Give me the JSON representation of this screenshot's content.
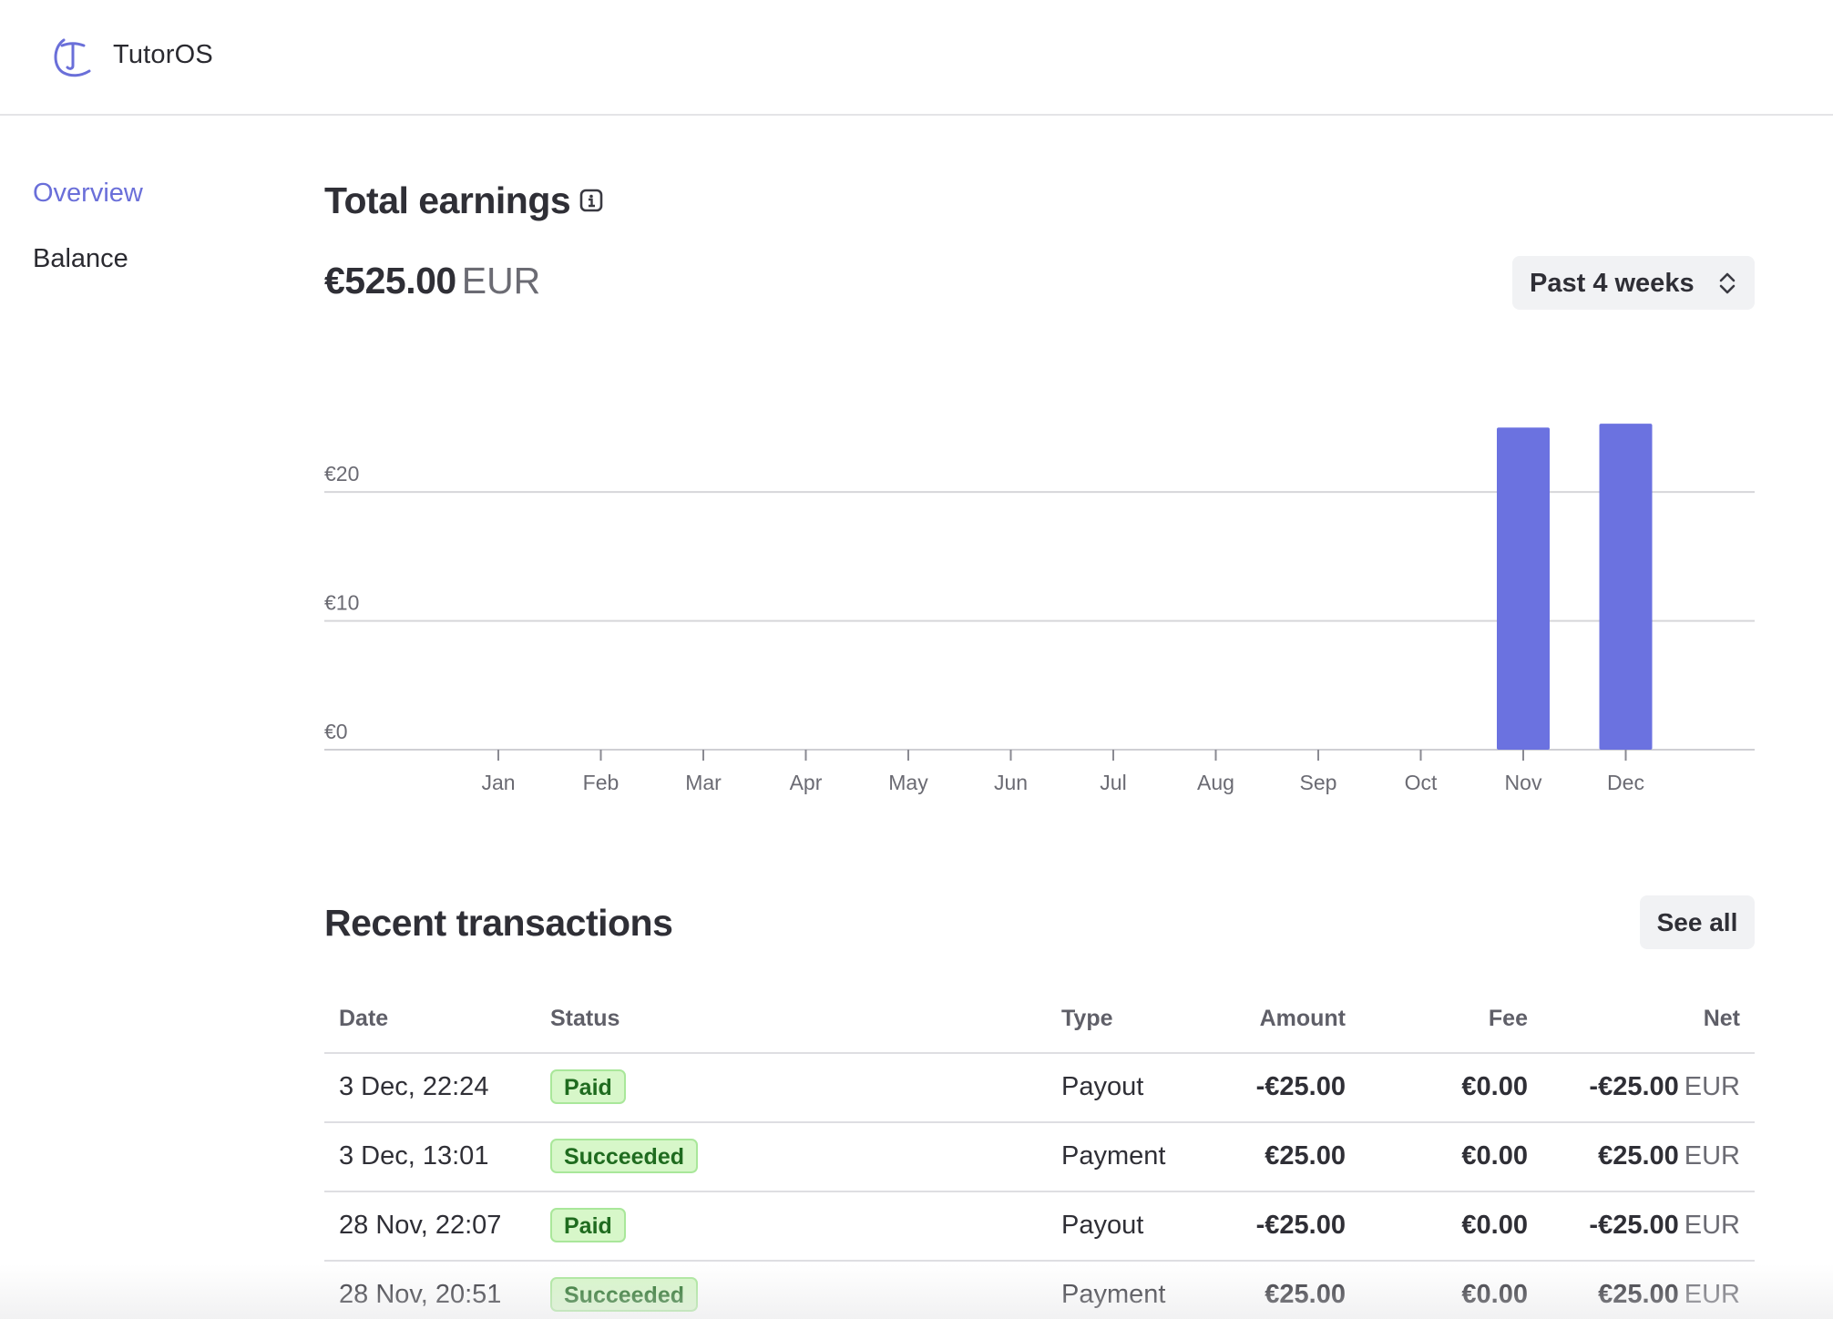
{
  "app": {
    "name": "TutorOS"
  },
  "nav": {
    "items": [
      {
        "label": "Overview"
      },
      {
        "label": "Balance"
      }
    ]
  },
  "earnings": {
    "title": "Total earnings",
    "amount": "€525.00",
    "currency": "EUR",
    "period": {
      "selected": "Past 4 weeks"
    }
  },
  "chart_data": {
    "type": "bar",
    "categories": [
      "Jan",
      "Feb",
      "Mar",
      "Apr",
      "May",
      "Jun",
      "Jul",
      "Aug",
      "Sep",
      "Oct",
      "Nov",
      "Dec"
    ],
    "values": [
      0,
      0,
      0,
      0,
      0,
      0,
      0,
      0,
      0,
      0,
      25,
      25.3
    ],
    "ylim": [
      0,
      28
    ],
    "yticks": [
      {
        "value": 0,
        "label": "€0"
      },
      {
        "value": 10,
        "label": "€10"
      },
      {
        "value": 20,
        "label": "€20"
      }
    ],
    "grid": true,
    "color": "#6b72e0"
  },
  "transactions": {
    "title": "Recent transactions",
    "see_all_label": "See all",
    "columns": {
      "date": "Date",
      "status": "Status",
      "type": "Type",
      "amount": "Amount",
      "fee": "Fee",
      "net": "Net"
    },
    "rows": [
      {
        "date": "3 Dec, 22:24",
        "status": "Paid",
        "type": "Payout",
        "amount": "-€25.00",
        "fee": "€0.00",
        "net": "-€25.00",
        "net_currency": "EUR"
      },
      {
        "date": "3 Dec, 13:01",
        "status": "Succeeded",
        "type": "Payment",
        "amount": "€25.00",
        "fee": "€0.00",
        "net": "€25.00",
        "net_currency": "EUR"
      },
      {
        "date": "28 Nov, 22:07",
        "status": "Paid",
        "type": "Payout",
        "amount": "-€25.00",
        "fee": "€0.00",
        "net": "-€25.00",
        "net_currency": "EUR"
      },
      {
        "date": "28 Nov, 20:51",
        "status": "Succeeded",
        "type": "Payment",
        "amount": "€25.00",
        "fee": "€0.00",
        "net": "€25.00",
        "net_currency": "EUR"
      }
    ]
  },
  "colors": {
    "accent": "#6a6fd9",
    "bar": "#6b72e0",
    "badge_bg": "#d7f7c9",
    "badge_text": "#1f6b1f"
  }
}
